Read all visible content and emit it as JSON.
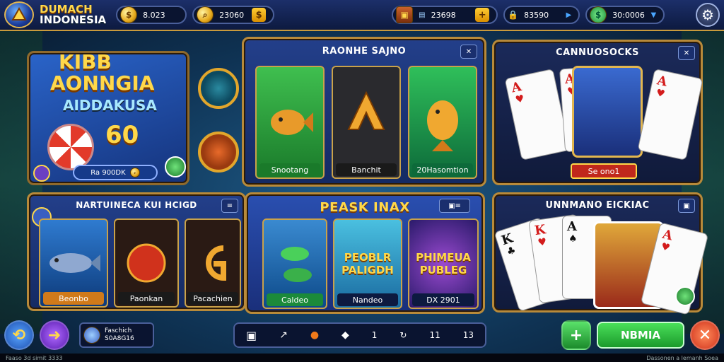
{
  "logo": {
    "line1": "DUMACH",
    "line2": "INDONESIA"
  },
  "top_bar": {
    "coins": "8.023",
    "gems": "23060",
    "tickets": "23698",
    "energy": "83590",
    "cash": "30:0006"
  },
  "promo": {
    "title_line1": "KIBB",
    "title_line2": "AONNGIA",
    "title_line3": "AIDDAKUSA",
    "number": "60",
    "button": "Ra 900DK"
  },
  "slots_panel": {
    "title": "RAONHE SAJNO",
    "tiles": [
      {
        "label": "Snootang"
      },
      {
        "label": "Banchit"
      },
      {
        "label": "20Hasomtion"
      }
    ]
  },
  "cards_panel": {
    "title": "CANNUOSOCKS",
    "button": "Se ono1"
  },
  "fish_panel": {
    "title": "NARTUINECA KUI HCIGD",
    "tiles": [
      {
        "label": "Beonbo"
      },
      {
        "label": "Paonkan"
      },
      {
        "label": "Pacachien"
      }
    ]
  },
  "peak_panel": {
    "title": "PEASK INAX",
    "tiles": [
      {
        "label": "Caldeo",
        "art": ""
      },
      {
        "label": "Nandeo",
        "art": "PEOBLR PALIGDH"
      },
      {
        "label": "DX 2901",
        "art": "PHIMEUA PUBLEG"
      }
    ]
  },
  "poker_panel": {
    "title": "UNNMANO EICKIAC"
  },
  "bottom": {
    "profile_line1": "Faschich",
    "profile_line2": "S0A8G16",
    "action_button": "NBMIA",
    "dock_items": [
      "1",
      "11",
      "13"
    ]
  },
  "footer": {
    "left": "Faaso 3d simit 3333",
    "right": "Dassonen a lemanh Soea"
  },
  "colors": {
    "green": "#22b04a",
    "gold": "#c9a24a",
    "red": "#e24a1c"
  }
}
